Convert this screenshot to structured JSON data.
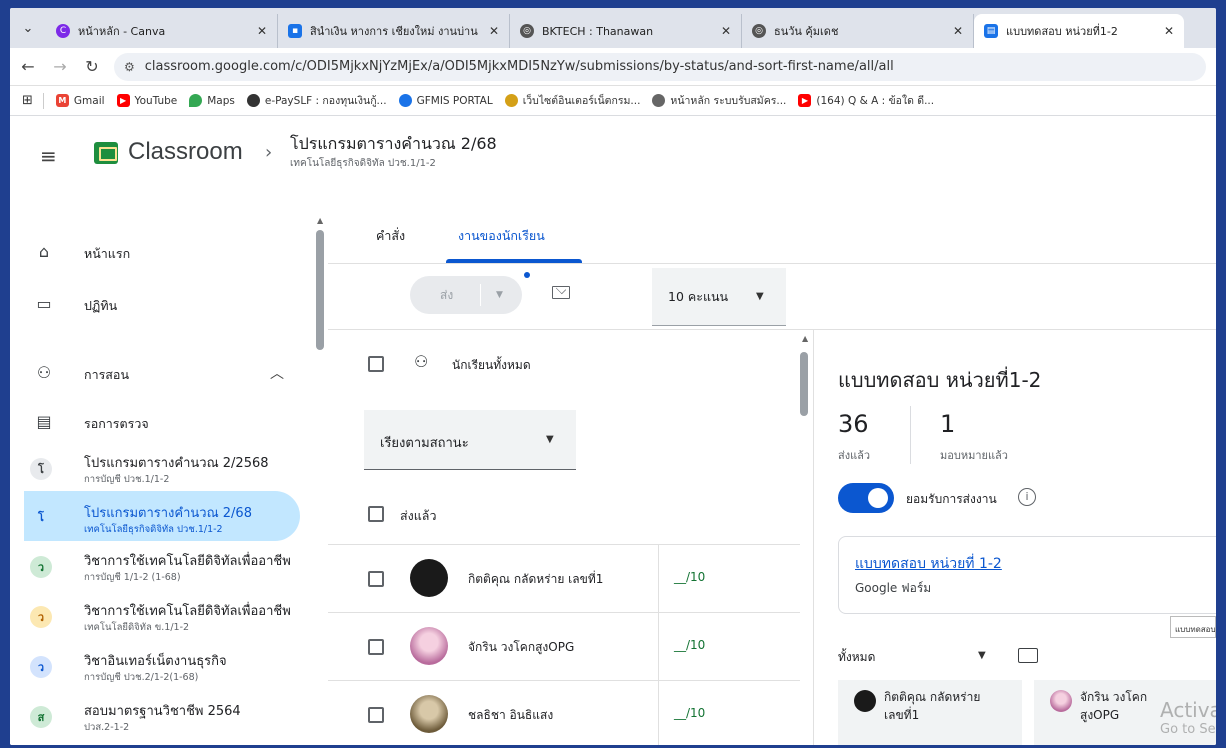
{
  "browser": {
    "tabs": [
      {
        "title": "หน้าหลัก - Canva",
        "color": "#7d2ae8",
        "active": false
      },
      {
        "title": "สินำเงิน หางการ เชียงใหม่ งานบ่าน",
        "color": "#1a73e8",
        "active": false
      },
      {
        "title": "BKTECH : Thanawan",
        "color": "#555555",
        "active": false
      },
      {
        "title": "ธนวัน คุ้มเดช",
        "color": "#555555",
        "active": false
      },
      {
        "title": "แบบทดสอบ หน่วยที่1-2",
        "color": "#1a73e8",
        "active": true
      }
    ],
    "url": "classroom.google.com/c/ODI5MjkxNjYzMjEx/a/ODI5MjkxMDI5NzYw/submissions/by-status/and-sort-first-name/all/all",
    "bookmarks": [
      {
        "label": "Gmail",
        "color": "#ea4335"
      },
      {
        "label": "YouTube",
        "color": "#ff0000"
      },
      {
        "label": "Maps",
        "color": "#34a853"
      },
      {
        "label": "e-PaySLF : กองทุนเงินกู้...",
        "color": "#333333"
      },
      {
        "label": "GFMIS PORTAL",
        "color": "#1a73e8"
      },
      {
        "label": "เว็บไซต์อินเตอร์เน็ตกรม...",
        "color": "#d4a017"
      },
      {
        "label": "หน้าหลัก ระบบรับสมัคร...",
        "color": "#666666"
      },
      {
        "label": "(164) Q & A : ข้อใด ดี...",
        "color": "#ff0000"
      }
    ]
  },
  "header": {
    "app_name": "Classroom",
    "course_title": "โปรแกรมตารางคำนวณ 2/68",
    "course_subtitle": "เทคโนโลยีธุรกิจดิจิทัล ปวช.1/1-2"
  },
  "sidebar": {
    "home": "หน้าแรก",
    "calendar": "ปฏิทิน",
    "teaching": "การสอน",
    "to_review": "รอการตรวจ",
    "courses": [
      {
        "initial": "โ",
        "title": "โปรแกรมตารางคำนวณ 2/2568",
        "sub": "การบัญชี ปวช.1/1-2",
        "bg": "#e8eaed",
        "fg": "#3c4043"
      },
      {
        "initial": "โ",
        "title": "โปรแกรมตารางคำนวณ 2/68",
        "sub": "เทคโนโลยีธุรกิจดิจิทัล ปวช.1/1-2",
        "bg": "#c2e7ff",
        "fg": "#0b57d0"
      },
      {
        "initial": "ว",
        "title": "วิชาการใช้เทคโนโลยีดิจิทัลเพื่ออาชีพ",
        "sub": "การบัญชี 1/1-2 (1-68)",
        "bg": "#ceead6",
        "fg": "#137333"
      },
      {
        "initial": "ว",
        "title": "วิชาการใช้เทคโนโลยีดิจิทัลเพื่ออาชีพ",
        "sub": "เทคโนโลยีดิจิทัล ข.1/1-2",
        "bg": "#fce8b2",
        "fg": "#b06000"
      },
      {
        "initial": "ว",
        "title": "วิชาอินเทอร์เน็ตงานธุรกิจ",
        "sub": "การบัญชี ปวช.2/1-2(1-68)",
        "bg": "#d3e3fd",
        "fg": "#0b57d0"
      },
      {
        "initial": "ส",
        "title": "สอบมาตรฐานวิชาชีพ 2564",
        "sub": "ปวส.2-1-2",
        "bg": "#ceead6",
        "fg": "#137333"
      }
    ]
  },
  "main": {
    "tabs": [
      "คำสั่ง",
      "งานของนักเรียน"
    ],
    "send_label": "ส่ง",
    "points_label": "10 คะแนน",
    "all_students": "นักเรียนทั้งหมด",
    "sort_label": "เรียงตามสถานะ",
    "section_submitted": "ส่งแล้ว",
    "students": [
      {
        "name": "กิตติคุณ กลัดหร่าย เลขที่1",
        "score": "__/10",
        "avatar": "#1a1a1a"
      },
      {
        "name": "จักริน วงโคกสูงOPG",
        "score": "__/10",
        "avatar": "#c98fb8"
      },
      {
        "name": "ชลธิชา อินธิแสง",
        "score": "__/10",
        "avatar": "#8a7a5a"
      }
    ]
  },
  "detail": {
    "title": "แบบทดสอบ หน่วยที่1-2",
    "submitted_count": "36",
    "submitted_label": "ส่งแล้ว",
    "assigned_count": "1",
    "assigned_label": "มอบหมายแล้ว",
    "accept_label": "ยอมรับการส่งงาน",
    "form_link": "แบบทดสอบ หน่วยที่ 1-2",
    "form_type": "Google ฟอร์ม",
    "tooltip": "แบบทดสอบ",
    "filter_label": "ทั้งหมด",
    "cards": [
      {
        "name": "กิตติคุณ กลัดหร่าย\nเลขที่1",
        "avatar": "#1a1a1a"
      },
      {
        "name": "จักริน วงโคก\nสูงOPG",
        "avatar": "#c98fb8"
      }
    ]
  },
  "watermark": {
    "line1": "Activate",
    "line2": "Go to Sett"
  }
}
